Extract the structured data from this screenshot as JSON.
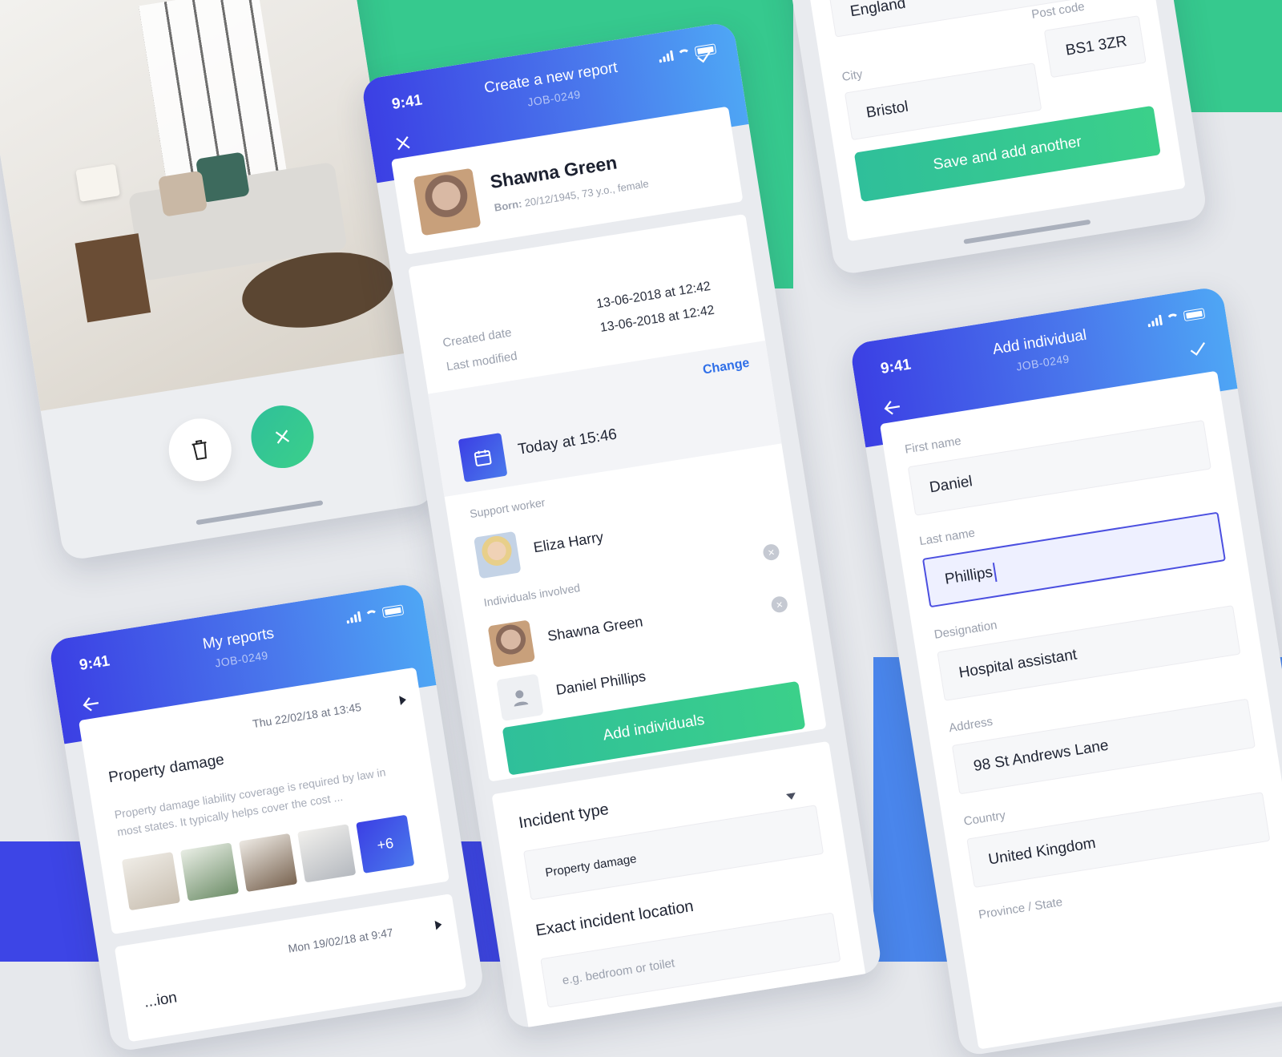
{
  "colors": {
    "green": "#3ac98f",
    "blue": "#3b3fe4",
    "link": "#2f6fe8"
  },
  "status_time": "9:41",
  "photo_screen": {
    "delete_icon": "trash-icon",
    "close_icon": "close-icon"
  },
  "new_report": {
    "title": "Create a new report",
    "job": "JOB-0249",
    "close_icon": "close-icon",
    "confirm_icon": "check-icon",
    "person_name": "Shawna Green",
    "person_born_label": "Born:",
    "person_born_value": "20/12/1945, 73 y.o., female",
    "created_label": "Created date",
    "created_value": "13-06-2018 at 12:42",
    "modified_label": "Last modified",
    "modified_value": "13-06-2018 at 12:42",
    "change_label": "Change",
    "date_value": "Today at 15:46",
    "support_label": "Support worker",
    "support_name": "Eliza Harry",
    "individuals_label": "Individuals involved",
    "individuals": [
      {
        "name": "Shawna Green"
      },
      {
        "name": "Daniel Phillips"
      }
    ],
    "add_button": "Add individuals",
    "incident_type_label": "Incident type",
    "incident_type_value": "Property damage",
    "location_label": "Exact incident location",
    "location_placeholder": "e.g. bedroom or toilet"
  },
  "address_screen": {
    "county_value": "England",
    "city_label": "City",
    "city_value": "Bristol",
    "postcode_label": "Post code",
    "postcode_value": "BS1 3ZR",
    "save_button": "Save and add another"
  },
  "my_reports": {
    "title": "My reports",
    "job": "JOB-0249",
    "back_icon": "arrow-left-icon",
    "items": [
      {
        "type": "Property damage",
        "date": "Thu 22/02/18 at 13:45",
        "description": "Property damage liability coverage is required by law in most states. It typically helps cover the cost ...",
        "more": "+6"
      },
      {
        "type": "...ion",
        "date": "Mon 19/02/18 at 9:47"
      }
    ]
  },
  "add_individual": {
    "title": "Add individual",
    "job": "JOB-0249",
    "back_icon": "arrow-left-icon",
    "confirm_icon": "check-icon",
    "first_name_label": "First name",
    "first_name_value": "Daniel",
    "last_name_label": "Last name",
    "last_name_value": "Phillips",
    "designation_label": "Designation",
    "designation_value": "Hospital assistant",
    "address_label": "Address",
    "address_value": "98 St Andrews Lane",
    "country_label": "Country",
    "country_value": "United Kingdom",
    "province_label": "Province / State"
  }
}
